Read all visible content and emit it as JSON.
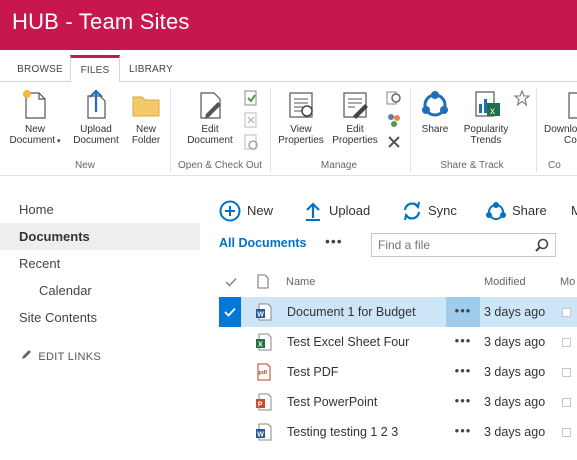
{
  "suite": {
    "title": "HUB - Team Sites",
    "brand_color": "#c8174f"
  },
  "ribbon_tabs": [
    {
      "label": "BROWSE",
      "active": false
    },
    {
      "label": "FILES",
      "active": true
    },
    {
      "label": "LIBRARY",
      "active": false
    }
  ],
  "ribbon": {
    "groups": {
      "new": "New",
      "open_checkout": "Open & Check Out",
      "manage": "Manage",
      "share_track": "Share & Track",
      "copies": "Co"
    },
    "buttons": {
      "new_document_1": "New",
      "new_document_2": "Document",
      "upload_1": "Upload",
      "upload_2": "Document",
      "new_folder_1": "New",
      "new_folder_2": "Folder",
      "edit_document_1": "Edit",
      "edit_document_2": "Document",
      "view_properties_1": "View",
      "view_properties_2": "Properties",
      "edit_properties_1": "Edit",
      "edit_properties_2": "Properties",
      "share": "Share",
      "popularity_1": "Popularity",
      "popularity_2": "Trends",
      "download_1": "Downlo",
      "download_2": "Cop"
    }
  },
  "leftnav": {
    "items": [
      {
        "label": "Home"
      },
      {
        "label": "Documents"
      },
      {
        "label": "Recent"
      },
      {
        "label": "Calendar"
      },
      {
        "label": "Site Contents"
      }
    ],
    "edit_links": "EDIT LINKS"
  },
  "commands": {
    "new": "New",
    "upload": "Upload",
    "sync": "Sync",
    "share": "Share",
    "more": "M"
  },
  "view": {
    "current": "All Documents",
    "more": "•••",
    "search_placeholder": "Find a file"
  },
  "columns": {
    "name": "Name",
    "modified": "Modified",
    "modified_by": "Mo"
  },
  "documents": [
    {
      "name": "Document 1 for Budget",
      "modified": "3 days ago",
      "type": "word",
      "more": "•••"
    },
    {
      "name": "Test Excel Sheet Four",
      "modified": "3 days ago",
      "type": "excel",
      "more": "•••"
    },
    {
      "name": "Test PDF",
      "modified": "3 days ago",
      "type": "pdf",
      "more": "•••"
    },
    {
      "name": "Test PowerPoint",
      "modified": "3 days ago",
      "type": "powerpoint",
      "more": "•••"
    },
    {
      "name": "Testing testing 1 2 3",
      "modified": "3 days ago",
      "type": "word",
      "more": "•••"
    }
  ]
}
